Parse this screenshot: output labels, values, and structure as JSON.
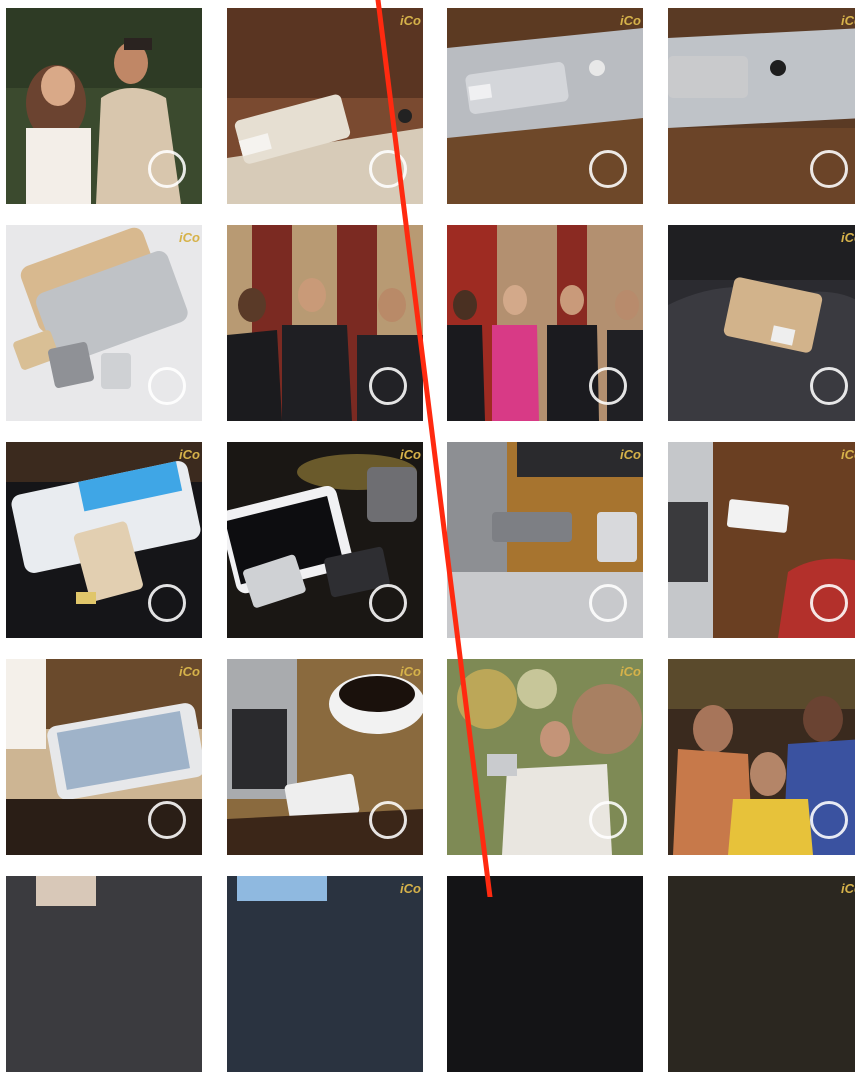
{
  "brand_label": "iCo",
  "tiles": [
    {
      "desc": "couple-portrait"
    },
    {
      "desc": "gold-drive-on-phone"
    },
    {
      "desc": "silver-drive-on-phone"
    },
    {
      "desc": "phone-with-drive-closeup"
    },
    {
      "desc": "product-lineup"
    },
    {
      "desc": "three-men-launch"
    },
    {
      "desc": "launch-group-photo"
    },
    {
      "desc": "drive-on-dark-fabric"
    },
    {
      "desc": "phone-with-drive-and-keyboard"
    },
    {
      "desc": "phone-and-drives-on-desk"
    },
    {
      "desc": "drive-on-wooden-desk"
    },
    {
      "desc": "drive-with-laptop"
    },
    {
      "desc": "phone-with-coffee"
    },
    {
      "desc": "laptop-coffee-drive"
    },
    {
      "desc": "selfie-with-drive"
    },
    {
      "desc": "friends-with-phone"
    },
    {
      "desc": "partial-tile"
    },
    {
      "desc": "partial-tile"
    },
    {
      "desc": "partial-tile"
    },
    {
      "desc": "partial-tile"
    }
  ],
  "colors": {
    "brand": "#d6b24a",
    "annotation_line": "#ff2a10",
    "selector_ring": "#ffffff"
  }
}
